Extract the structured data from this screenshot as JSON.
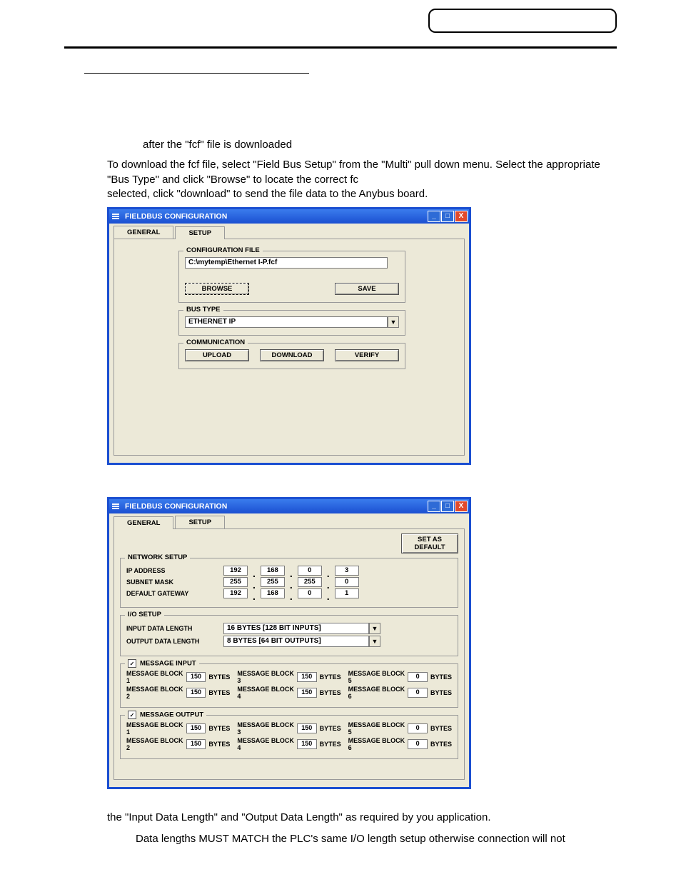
{
  "doc": {
    "line_after": "after the \"fcf\" file is downloaded",
    "para1": "To download the fcf file, select \"Field Bus Setup\" from the \"Multi\" pull down menu. Select the appropriate \"Bus Type\" and click \"Browse\" to locate the correct fc",
    "para1b": "selected, click \"download\" to send the file data to the Anybus board.",
    "para2": "the \"Input Data Length\" and \"Output Data Length\" as required by you application.",
    "note": "Data lengths MUST MATCH the PLC's same I/O length setup otherwise connection will not"
  },
  "win1": {
    "title": "FIELDBUS CONFIGURATION",
    "tabs": {
      "general": "GENERAL",
      "setup": "SETUP"
    },
    "config_file": {
      "legend": "CONFIGURATION FILE",
      "path": "C:\\mytemp\\Ethernet I-P.fcf",
      "browse": "BROWSE",
      "save": "SAVE"
    },
    "bus_type": {
      "legend": "BUS TYPE",
      "value": "ETHERNET IP"
    },
    "communication": {
      "legend": "COMMUNICATION",
      "upload": "UPLOAD",
      "download": "DOWNLOAD",
      "verify": "VERIFY"
    }
  },
  "win2": {
    "title": "FIELDBUS CONFIGURATION",
    "tabs": {
      "general": "GENERAL",
      "setup": "SETUP"
    },
    "set_default": "SET AS DEFAULT",
    "network": {
      "legend": "NETWORK SETUP",
      "ip_label": "IP ADDRESS",
      "ip": [
        "192",
        "168",
        "0",
        "3"
      ],
      "sn_label": "SUBNET MASK",
      "sn": [
        "255",
        "255",
        "255",
        "0"
      ],
      "gw_label": "DEFAULT GATEWAY",
      "gw": [
        "192",
        "168",
        "0",
        "1"
      ]
    },
    "io": {
      "legend": "I/O SETUP",
      "in_label": "INPUT DATA LENGTH",
      "in_value": "16 BYTES [128 BIT INPUTS]",
      "out_label": "OUTPUT DATA LENGTH",
      "out_value": "8 BYTES [64 BIT OUTPUTS]"
    },
    "msg_in": {
      "legend": "MESSAGE INPUT",
      "bytes": "BYTES",
      "b1l": "MESSAGE BLOCK 1",
      "b1": "150",
      "b2l": "MESSAGE BLOCK 2",
      "b2": "150",
      "b3l": "MESSAGE BLOCK 3",
      "b3": "150",
      "b4l": "MESSAGE BLOCK 4",
      "b4": "150",
      "b5l": "MESSAGE BLOCK 5",
      "b5": "0",
      "b6l": "MESSAGE BLOCK 6",
      "b6": "0"
    },
    "msg_out": {
      "legend": "MESSAGE OUTPUT",
      "bytes": "BYTES",
      "b1l": "MESSAGE BLOCK 1",
      "b1": "150",
      "b2l": "MESSAGE BLOCK 2",
      "b2": "150",
      "b3l": "MESSAGE BLOCK 3",
      "b3": "150",
      "b4l": "MESSAGE BLOCK 4",
      "b4": "150",
      "b5l": "MESSAGE BLOCK 5",
      "b5": "0",
      "b6l": "MESSAGE BLOCK 6",
      "b6": "0"
    }
  }
}
